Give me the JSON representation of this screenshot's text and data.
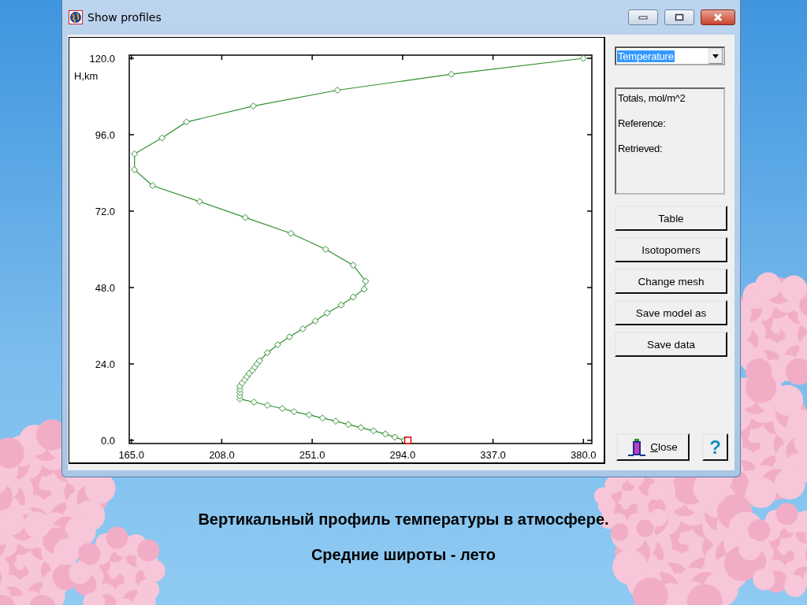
{
  "window": {
    "title": "Show profiles"
  },
  "chart": {
    "chart_data": {
      "type": "line",
      "ylabel": "H,km",
      "xlim": [
        164,
        384
      ],
      "ylim": [
        -1,
        121
      ],
      "xticks": [
        {
          "value": 165,
          "label": "165.0"
        },
        {
          "value": 208,
          "label": "208.0"
        },
        {
          "value": 251,
          "label": "251.0"
        },
        {
          "value": 294,
          "label": "294.0"
        },
        {
          "value": 337,
          "label": "337.0"
        },
        {
          "value": 380,
          "label": "380.0"
        }
      ],
      "yticks": [
        {
          "value": 0,
          "label": "0.0"
        },
        {
          "value": 24,
          "label": "24.0"
        },
        {
          "value": 48,
          "label": "48.0"
        },
        {
          "value": 72,
          "label": "72.0"
        },
        {
          "value": 96,
          "label": "96.0"
        },
        {
          "value": 120,
          "label": "120.0"
        }
      ],
      "series": [
        {
          "color": "#2f8f2f",
          "marker": "diamond",
          "x": [
            294.8,
            290.3,
            285.8,
            280.2,
            274.2,
            268.2,
            262.2,
            255.9,
            249.5,
            242.4,
            236.8,
            229.7,
            223.3,
            216.6,
            216.6,
            216.6,
            216.6,
            216.6,
            217.7,
            218.9,
            220.0,
            221.0,
            222.6,
            223.7,
            224.8,
            226.0,
            229.7,
            234.6,
            240.2,
            246.5,
            252.5,
            258.1,
            264.8,
            270.5,
            275.7,
            276.4,
            270.5,
            257.4,
            240.9,
            219.2,
            197.5,
            175.1,
            166.5,
            166.5,
            179.6,
            191.2,
            223.0,
            263.0,
            317.2,
            380.0
          ],
          "values": [
            0,
            1,
            2,
            3,
            4,
            5,
            6,
            7,
            8,
            9,
            10,
            11,
            12,
            13,
            14,
            15,
            16,
            17,
            18,
            19,
            20,
            21,
            22,
            23,
            24,
            25,
            27.5,
            30,
            32.5,
            35,
            37.5,
            40,
            42.5,
            45,
            47.5,
            50,
            55,
            60,
            65,
            70,
            75,
            80,
            85,
            90,
            95,
            100,
            105,
            110,
            115,
            120
          ]
        },
        {
          "color": "#e00000",
          "marker": "square",
          "x": [
            296.5
          ],
          "values": [
            0
          ]
        }
      ]
    }
  },
  "side_panel": {
    "profile_select": {
      "value": "Temperature"
    },
    "totals": {
      "heading": "Totals, mol/m^2",
      "reference": "Reference:",
      "retrieved": "Retrieved:"
    },
    "buttons": [
      "Table",
      "Isotopomers",
      "Change mesh",
      "Save model as",
      "Save data"
    ],
    "close_button": "Close",
    "help_button": "?"
  },
  "caption": [
    "Вертикальный профиль температуры в атмосфере.",
    "Средние широты - лето"
  ]
}
